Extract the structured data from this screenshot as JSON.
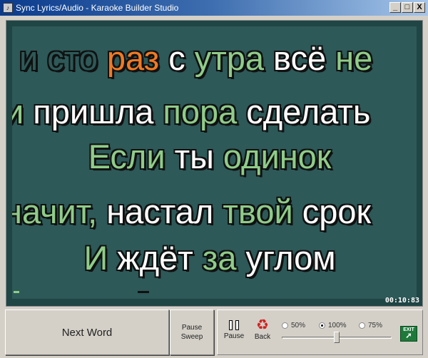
{
  "window": {
    "title": "Sync Lyrics/Audio - Karaoke Builder Studio",
    "controls": [
      "_",
      "□",
      "X"
    ]
  },
  "colors": {
    "background": "#2d5958",
    "sung": "#2d5958",
    "current": "#f07a22",
    "unsung_a": "#ffffff",
    "unsung_b": "#8fcc88"
  },
  "lyrics": [
    {
      "words": [
        {
          "text": "и",
          "state": "sung"
        },
        {
          "text": "сто",
          "state": "sung"
        },
        {
          "text": "раз",
          "state": "current"
        },
        {
          "text": "с",
          "state": "white"
        },
        {
          "text": "утра",
          "state": "green"
        },
        {
          "text": "всё",
          "state": "white"
        },
        {
          "text": "не",
          "state": "green"
        }
      ]
    },
    {
      "words": [
        {
          "text": "и",
          "state": "green"
        },
        {
          "text": "пришла",
          "state": "white"
        },
        {
          "text": "пора",
          "state": "green"
        },
        {
          "text": "сделать",
          "state": "white"
        }
      ]
    },
    {
      "words": [
        {
          "text": "Если",
          "state": "green"
        },
        {
          "text": "ты",
          "state": "white"
        },
        {
          "text": "одинок",
          "state": "green"
        }
      ]
    },
    {
      "words": [
        {
          "text": "начит,",
          "state": "green"
        },
        {
          "text": "настал",
          "state": "white"
        },
        {
          "text": "твой",
          "state": "green"
        },
        {
          "text": "срок",
          "state": "white"
        }
      ]
    },
    {
      "words": [
        {
          "text": "И",
          "state": "green"
        },
        {
          "text": "ждёт",
          "state": "white"
        },
        {
          "text": "за",
          "state": "green"
        },
        {
          "text": "углом",
          "state": "white"
        }
      ]
    }
  ],
  "time": "00:10:83",
  "buttons": {
    "next_word": "Next Word",
    "pause_sweep_1": "Pause",
    "pause_sweep_2": "Sweep",
    "pause": "Pause",
    "back": "Back",
    "exit": "EXIT"
  },
  "speed": {
    "options": [
      "50%",
      "100%",
      "75%"
    ],
    "selected": "100%",
    "slider_percent": 50
  }
}
